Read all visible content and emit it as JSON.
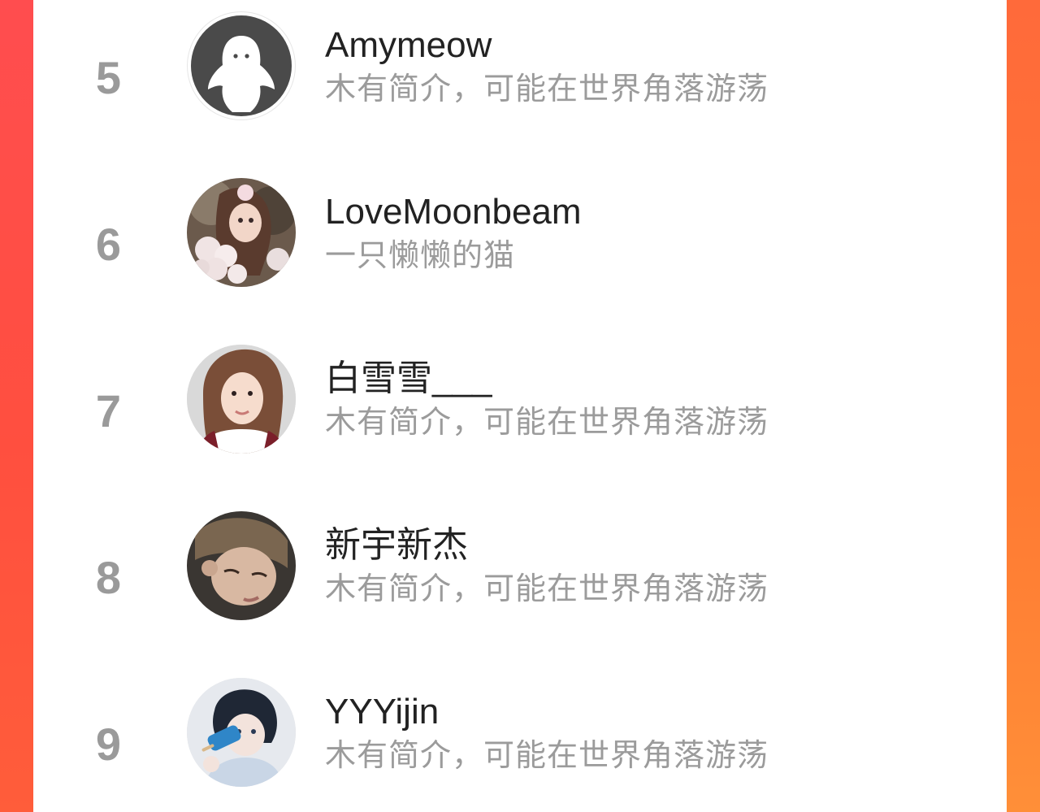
{
  "ranking": {
    "items": [
      {
        "rank": "5",
        "name": "Amymeow",
        "bio": "木有简介，可能在世界角落游荡",
        "avatar": "default-ghost-avatar"
      },
      {
        "rank": "6",
        "name": "LoveMoonbeam",
        "bio": "一只懒懒的猫",
        "avatar": "anime-girl-flowers-avatar"
      },
      {
        "rank": "7",
        "name": "白雪雪___",
        "bio": "木有简介，可能在世界角落游荡",
        "avatar": "girl-selfie-avatar"
      },
      {
        "rank": "8",
        "name": "新宇新杰",
        "bio": "木有简介，可能在世界角落游荡",
        "avatar": "boy-sleeping-avatar"
      },
      {
        "rank": "9",
        "name": "YYYijin",
        "bio": "木有简介，可能在世界角落游荡",
        "avatar": "anime-boy-popsicle-avatar"
      }
    ]
  },
  "colors": {
    "accent_left": "#ff4d4f",
    "accent_right": "#ff8a36",
    "rank_text": "#9a9a9a",
    "name_text": "#222222",
    "bio_text": "#9b9b9b"
  }
}
